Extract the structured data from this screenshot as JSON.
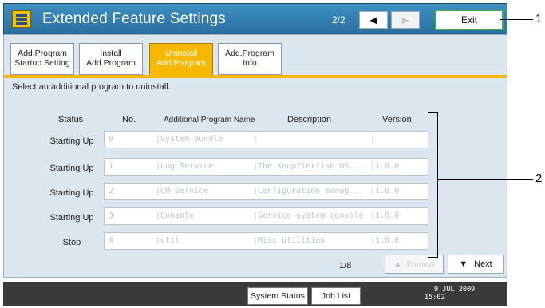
{
  "header": {
    "title": "Extended Feature Settings",
    "page_indicator": "2/2",
    "prev_page_glyph": "◀",
    "next_page_glyph": "▶",
    "exit_label": "Exit"
  },
  "callouts": {
    "one": "1",
    "two": "2"
  },
  "tabs": [
    {
      "line1": "Add.Program",
      "line2": "Startup Setting",
      "active": false
    },
    {
      "line1": "Install",
      "line2": "Add.Program",
      "active": false
    },
    {
      "line1": "Uninstall",
      "line2": "Add.Program",
      "active": true
    },
    {
      "line1": "Add.Program",
      "line2": "Info",
      "active": false
    }
  ],
  "instruction": "Select an additional program to uninstall.",
  "columns": [
    "Status",
    "No.",
    "Additional Program Name",
    "Description",
    "Version"
  ],
  "rows": [
    {
      "status": "Starting Up",
      "no": "0",
      "name": "|System Bundle",
      "description": "|",
      "version": "|"
    },
    {
      "status": "Starting Up",
      "no": "1",
      "name": "|Log Service",
      "description": "|The Knopflerfish OS...",
      "version": "|1.0.0"
    },
    {
      "status": "Starting Up",
      "no": "2",
      "name": "|CM Service",
      "description": "|Configuration manag...",
      "version": "|1.0.0"
    },
    {
      "status": "Starting Up",
      "no": "3",
      "name": "|Console",
      "description": "|Service system console",
      "version": "|1.0.0"
    },
    {
      "status": "Stop",
      "no": "4",
      "name": "|util",
      "description": "|Misc utilities",
      "version": "|1.0.0"
    }
  ],
  "pager": {
    "text": "1/8",
    "previous_label": "Previous",
    "next_label": "Next",
    "up_glyph": "▲",
    "down_glyph": "▼"
  },
  "status_bar": {
    "system_status": "System Status",
    "job_list": "Job List",
    "date": "9  JUL  2009",
    "time": "15:02"
  },
  "colors": {
    "title_bar": "#3f90c4",
    "active_tab": "#f6b800",
    "panel": "#dbe6ee",
    "exit_border": "#44aa44",
    "status_bar": "#3a3a3a"
  }
}
